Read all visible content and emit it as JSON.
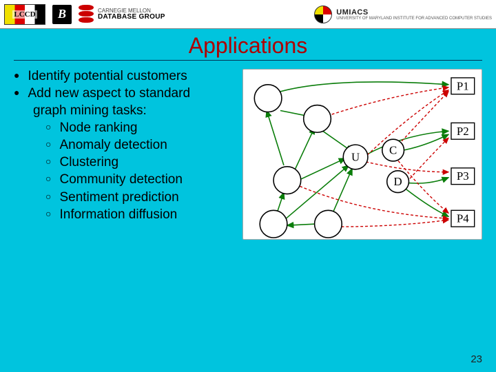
{
  "header": {
    "lccd_label": "LCCD",
    "b_label": "B",
    "cmu_top": "CARNEGIE MELLON",
    "cmu_bottom": "DATABASE GROUP",
    "umiacs_title": "UMIACS",
    "umiacs_sub": "UNIVERSITY OF MARYLAND INSTITUTE FOR ADVANCED COMPUTER STUDIES"
  },
  "title": "Applications",
  "bullets": {
    "b1": "Identify potential customers",
    "b2a": "Add new aspect to standard",
    "b2b": "graph mining tasks:",
    "sub": {
      "s1": "Node ranking",
      "s2": "Anomaly detection",
      "s3": "Clustering",
      "s4": "Community detection",
      "s5": "Sentiment prediction",
      "s6": "Information diffusion"
    }
  },
  "diagram": {
    "nodes": {
      "U": "U",
      "C": "C",
      "D": "D"
    },
    "products": {
      "P1": "P1",
      "P2": "P2",
      "P3": "P3",
      "P4": "P4"
    }
  },
  "page_number": "23"
}
